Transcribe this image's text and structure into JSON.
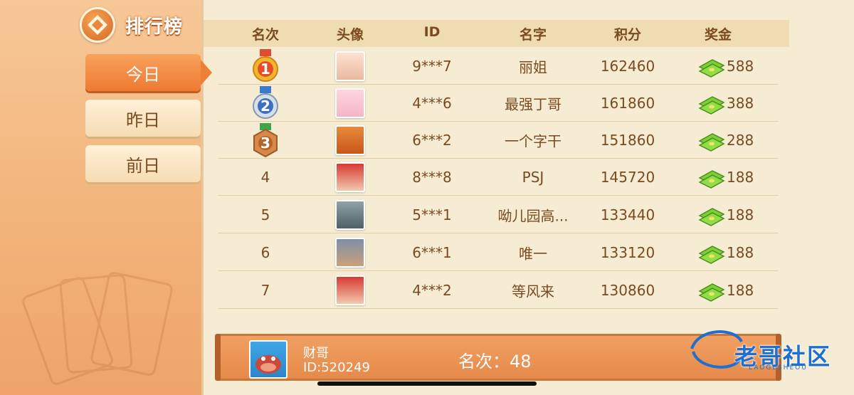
{
  "header": {
    "title": "排行榜",
    "logo_icon": "diamond-icon"
  },
  "tabs": [
    {
      "label": "今日",
      "active": true
    },
    {
      "label": "昨日",
      "active": false
    },
    {
      "label": "前日",
      "active": false
    }
  ],
  "table": {
    "columns": [
      "名次",
      "头像",
      "ID",
      "名字",
      "积分",
      "奖金"
    ],
    "rows": [
      {
        "rank": "1",
        "medal": "gold",
        "id": "9***7",
        "name": "丽姐",
        "score": "162460",
        "prize": "588"
      },
      {
        "rank": "2",
        "medal": "silver",
        "id": "4***6",
        "name": "最强丁哥",
        "score": "161860",
        "prize": "388"
      },
      {
        "rank": "3",
        "medal": "bronze",
        "id": "6***2",
        "name": "一个字干",
        "score": "151860",
        "prize": "288"
      },
      {
        "rank": "4",
        "medal": "",
        "id": "8***8",
        "name": "PSJ",
        "score": "145720",
        "prize": "188"
      },
      {
        "rank": "5",
        "medal": "",
        "id": "5***1",
        "name": "呦儿园高...",
        "score": "133440",
        "prize": "188"
      },
      {
        "rank": "6",
        "medal": "",
        "id": "6***1",
        "name": "唯一",
        "score": "133120",
        "prize": "188"
      },
      {
        "rank": "7",
        "medal": "",
        "id": "4***2",
        "name": "等风来",
        "score": "130860",
        "prize": "188"
      }
    ]
  },
  "me": {
    "name": "财哥",
    "id_label": "ID:520249",
    "rank_label": "名次：",
    "rank": "48"
  },
  "watermark": {
    "text": "老哥社区",
    "sub": "LAOGESHEOU"
  },
  "colors": {
    "accent": "#ee7a32",
    "text": "#7a4a20",
    "panel": "#f5ecd3"
  }
}
